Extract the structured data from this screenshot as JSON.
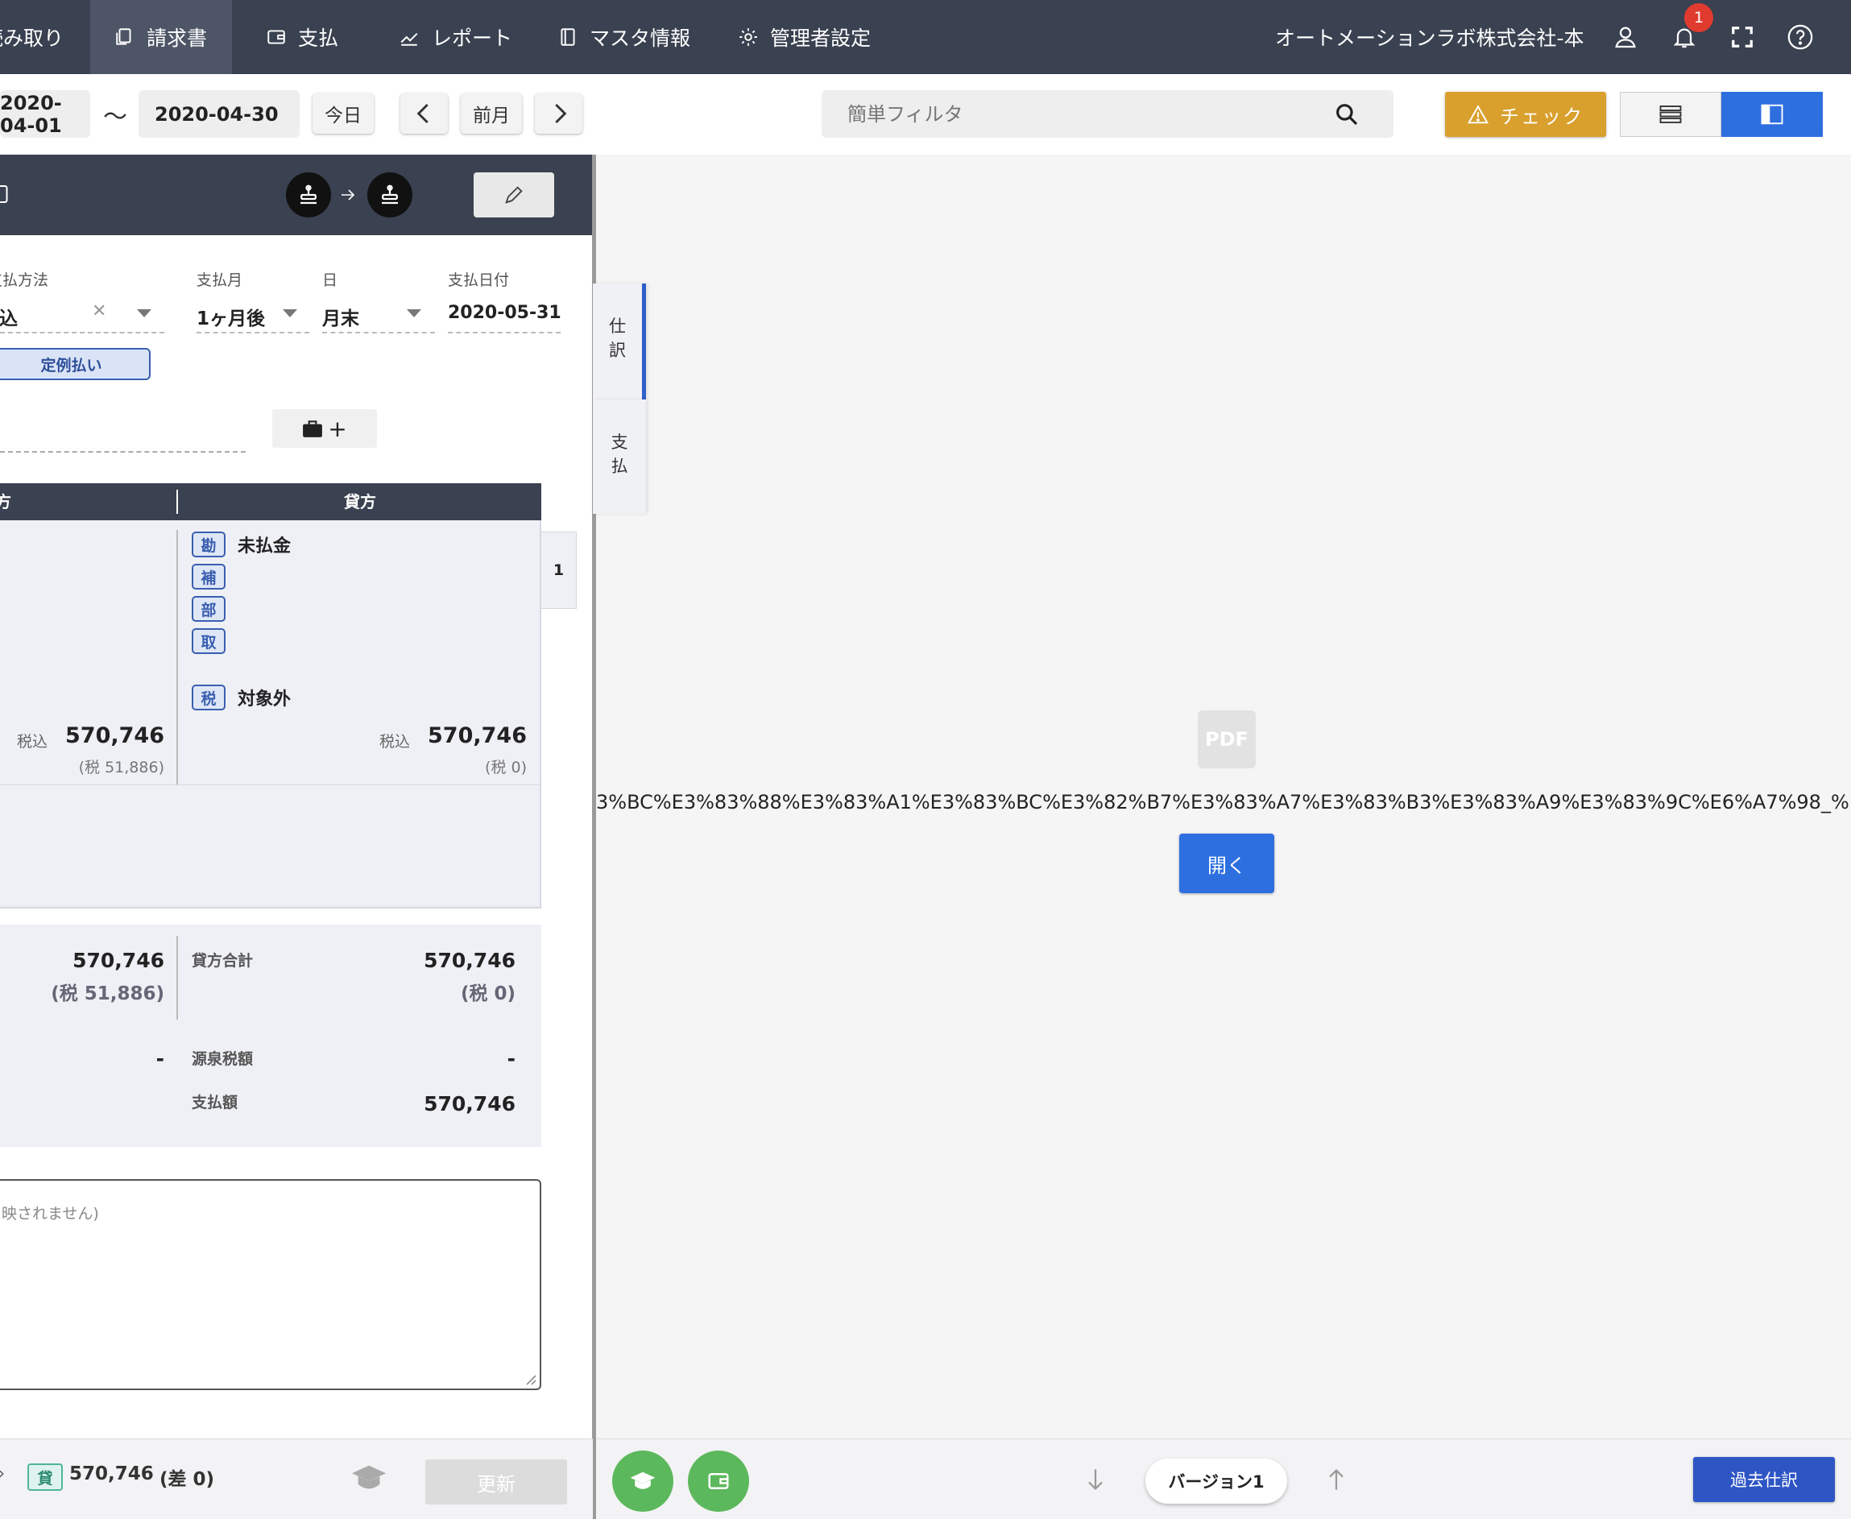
{
  "nav": {
    "items": [
      {
        "label": "読み取り",
        "icon": "scan-icon"
      },
      {
        "label": "請求書",
        "icon": "documents-icon"
      },
      {
        "label": "支払",
        "icon": "wallet-icon"
      },
      {
        "label": "レポート",
        "icon": "chart-line-icon"
      },
      {
        "label": "マスタ情報",
        "icon": "book-icon"
      },
      {
        "label": "管理者設定",
        "icon": "gear-icon"
      }
    ],
    "company": "オートメーションラボ株式会社-本",
    "notification_count": "1"
  },
  "toolbar": {
    "date_from": "2020-04-01",
    "date_sep": "〜",
    "date_to": "2020-04-30",
    "today_label": "今日",
    "prev_month_label": "前月",
    "filter_placeholder": "簡単フィルタ",
    "check_label": "チェック"
  },
  "payment": {
    "method_label": "支払方法",
    "method_value": "振込",
    "month_label": "支払月",
    "month_value": "1ヶ月後",
    "day_label": "日",
    "day_value": "月末",
    "date_label": "支払日付",
    "date_value": "2020-05-31",
    "recurring_label": "定例払い"
  },
  "journal": {
    "debit_header": "借方",
    "credit_header": "貸方",
    "row_number": "1",
    "credit_account": "未払金",
    "tax_value": "対象外",
    "tags": {
      "account": "勘",
      "sub": "補",
      "dept": "部",
      "partner": "取",
      "tax": "税"
    },
    "tax_incl_label": "税込",
    "debit_amount": "570,746",
    "debit_tax": "(税 51,886)",
    "credit_amount": "570,746",
    "credit_tax": "(税 0)"
  },
  "totals": {
    "debit_total": "570,746",
    "debit_total_tax": "(税 51,886)",
    "credit_total_label": "貸方合計",
    "credit_total": "570,746",
    "credit_total_tax": "(税 0)",
    "withholding_label": "源泉税額",
    "debit_withholding": "-",
    "credit_withholding": "-",
    "payment_amount_label": "支払額",
    "payment_amount": "570,746"
  },
  "memo": {
    "placeholder_tail": "映されません)"
  },
  "side_tabs": {
    "journal": "仕訳",
    "payment": "支払"
  },
  "pdf": {
    "icon_label": "PDF",
    "filename": "3%BC%E3%83%88%E3%83%A1%E3%83%BC%E3%82%B7%E3%83%A7%E3%83%B3%E3%83%A9%E3%83%9C%E6%A7%98_%E3%",
    "open_label": "開く"
  },
  "bottom_left": {
    "credit_tag": "貸",
    "credit_amount": "570,746",
    "difference": "(差 0)",
    "update_label": "更新"
  },
  "bottom_right": {
    "version_label": "バージョン1",
    "past_journal_label": "過去仕訳"
  },
  "colors": {
    "nav_bg": "#3a4150",
    "check_btn": "#d9a02e",
    "primary": "#2e6fe0",
    "green": "#5cb85c",
    "past_btn": "#2d55c4"
  }
}
